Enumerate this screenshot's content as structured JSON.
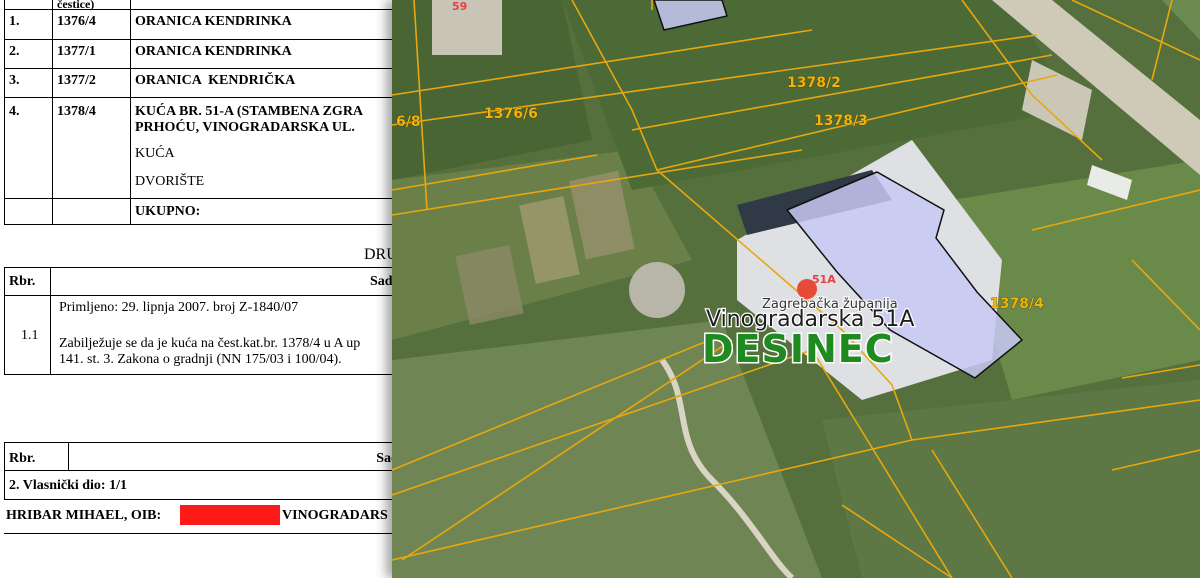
{
  "document": {
    "ownership_table": {
      "header_fragment": "čestice)",
      "rows": [
        {
          "no": "1.",
          "parcel": "1376/4",
          "desc_lines": [
            "ORANICA KENDRINKA"
          ]
        },
        {
          "no": "2.",
          "parcel": "1377/1",
          "desc_lines": [
            "ORANICA KENDRINKA"
          ]
        },
        {
          "no": "3.",
          "parcel": "1377/2",
          "desc_lines": [
            "ORANICA  KENDRIČKA"
          ]
        },
        {
          "no": "4.",
          "parcel": "1378/4",
          "desc_lines": [
            "KUĆA BR. 51-A (STAMBENA ZGRA",
            "PRHOĆU, VINOGRADARSKA UL."
          ],
          "sub_lines": [
            "KUĆA",
            "DVORIŠTE"
          ]
        },
        {
          "no": "",
          "parcel": "",
          "desc_lines": [
            "UKUPNO:"
          ]
        }
      ]
    },
    "section_heading": "DRU",
    "entries_table": {
      "col_rbr": "Rbr.",
      "col_sadrzaj": "Sadrž",
      "entry_no": "1.1",
      "received": "Primljeno: 29. lipnja 2007. broj Z-1840/07",
      "text_line1": "Zabilježuje se da je kuća na čest.kat.br. 1378/4 u A up",
      "text_line2": "141. st. 3. Zakona o gradnji (NN 175/03 i 100/04)."
    },
    "owners_table": {
      "col_rbr": "Rbr.",
      "col_sadrzaj": "Sadr",
      "share": "2. Vlasnički dio: 1/1",
      "owner_prefix": "HRIBAR MIHAEL, OIB:",
      "owner_suffix": "VINOGRADARS"
    }
  },
  "map": {
    "colors": {
      "parcel_line": "#e8a70e",
      "building_fill": "#c8c8f5",
      "pin": "#e84a3a",
      "place": "#1f8a1f"
    },
    "parcel_labels": [
      "1378/2",
      "1378/3",
      "1376/6",
      "6/8",
      "1378/4"
    ],
    "top_label": "59",
    "pin_label": "51A",
    "county_label": "Zagrebačka županija",
    "address_label": "Vinogradarska 51A",
    "place_label": "DESINEC"
  }
}
